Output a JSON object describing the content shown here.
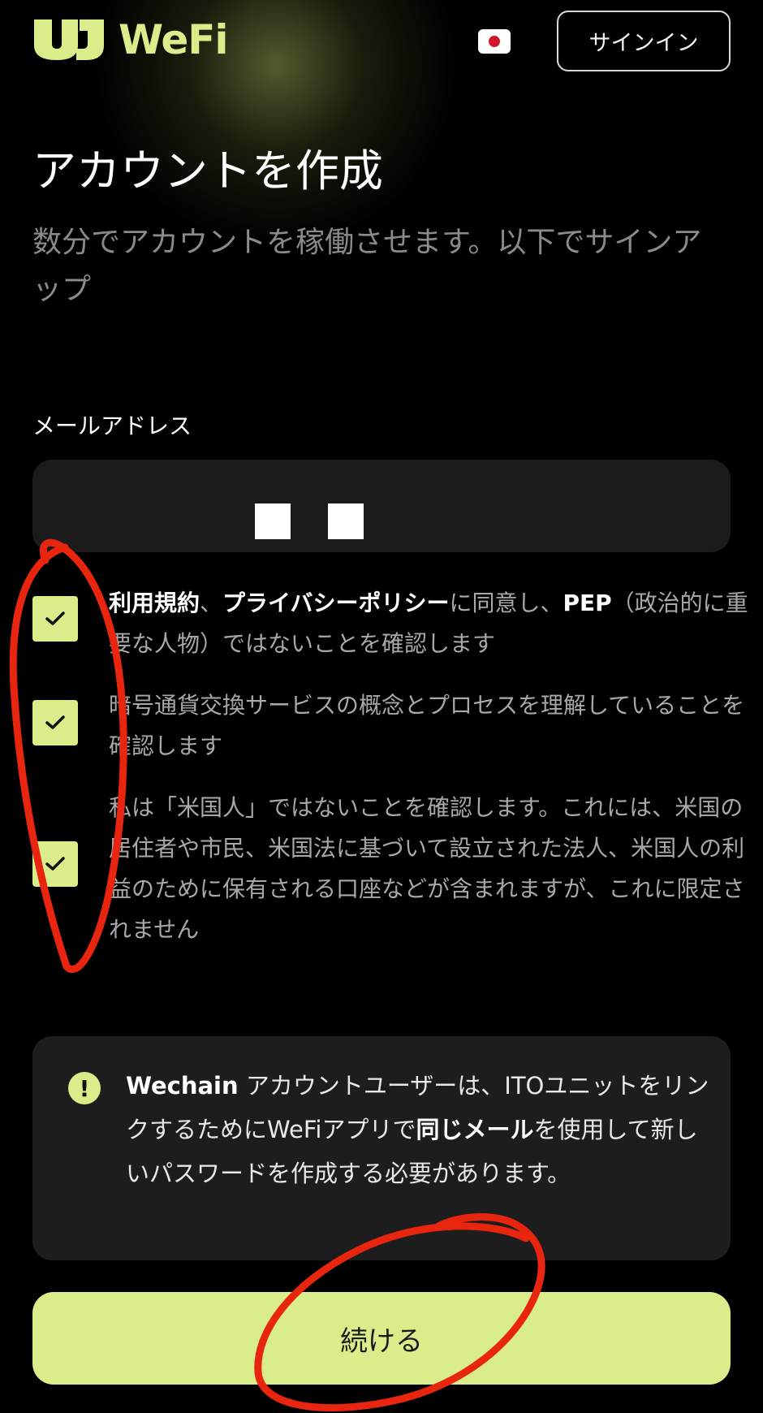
{
  "header": {
    "logo_text": "WeFi",
    "signin_label": "サインイン",
    "flag_icon": "japan-flag-icon"
  },
  "page": {
    "title": "アカウントを作成",
    "subtitle": "数分でアカウントを稼働させます。以下でサインアップ"
  },
  "form": {
    "email_label": "メールアドレス",
    "email_value": ""
  },
  "agreements": [
    {
      "checked": true,
      "link1": "利用規約",
      "sep": "、",
      "link2": "プライバシーポリシー",
      "mid": "に同意し、",
      "strong": "PEP",
      "rest": "（政治的に重要な人物）ではないことを確認します"
    },
    {
      "checked": true,
      "text": "暗号通貨交換サービスの概念とプロセスを理解していることを確認します"
    },
    {
      "checked": true,
      "text": "私は「米国人」ではないことを確認します。これには、米国の居住者や市民、米国法に基づいて設立された法人、米国人の利益のために保有される口座などが含まれますが、これに限定されません"
    }
  ],
  "notice": {
    "icon": "exclamation-icon",
    "brand": "Wechain",
    "text1": " アカウントユーザーは、ITOユニットをリンクするためにWeFiアプリで",
    "strong": "同じメール",
    "text2": "を使用して新しいパスワードを作成する必要があります。"
  },
  "actions": {
    "continue_label": "続ける"
  },
  "colors": {
    "accent": "#d9ee8a",
    "background": "#000000",
    "annotation": "#e8250f"
  }
}
